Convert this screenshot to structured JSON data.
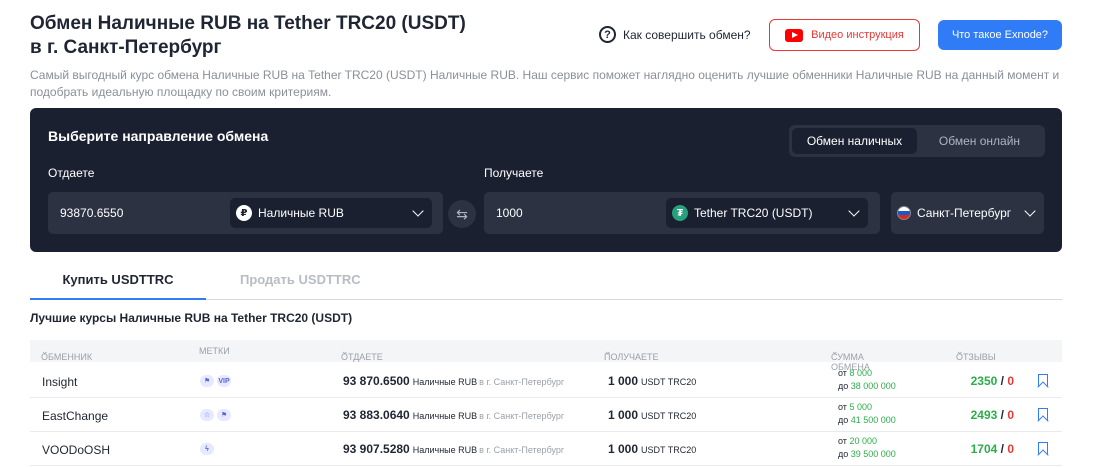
{
  "header": {
    "title_line1": "Обмен Наличные RUB на Tether TRC20 (USDT)",
    "title_line2": "в г. Санкт-Петербург",
    "howto": "Как совершить обмен?",
    "video_btn": "Видео инструкция",
    "exnode_btn": "Что такое Exnode?",
    "description": "Самый выгодный курс обмена Наличные RUB на Tether TRC20 (USDT) Наличные RUB. Наш сервис поможет наглядно оценить лучшие обменники Наличные RUB на данный момент и подобрать идеальную площадку по своим критериям."
  },
  "exchange": {
    "title": "Выберите направление обмена",
    "mode_cash": "Обмен наличных",
    "mode_online": "Обмен онлайн",
    "give_label": "Отдаете",
    "receive_label": "Получаете",
    "give_amount": "93870.6550",
    "give_currency": "Наличные RUB",
    "receive_amount": "1000",
    "receive_currency": "Tether TRC20 (USDT)",
    "city": "Санкт-Петербург"
  },
  "tabs": {
    "buy": "Купить USDTTRC",
    "sell": "Продать USDTTRC"
  },
  "table": {
    "title": "Лучшие курсы Наличные RUB на Tether TRC20 (USDT)",
    "columns": {
      "exchanger": "ОБМЕННИК",
      "tags": "МЕТКИ",
      "give": "ОТДАЕТЕ",
      "receive": "ПОЛУЧАЕТЕ",
      "sum": "СУММА ОБМЕНА",
      "reviews": "ОТЗЫВЫ"
    },
    "rows": [
      {
        "name": "Insight",
        "give": "93 870.6500",
        "give_cur": "Наличные RUB",
        "city": "в г. Санкт-Петербург",
        "recv": "1 000",
        "recv_cur": "USDT TRC20",
        "from_label": "от ",
        "from": "8 000",
        "to_label": "до ",
        "to": "38 000 000",
        "pos": "2350",
        "neg": "0"
      },
      {
        "name": "EastChange",
        "give": "93 883.0640",
        "give_cur": "Наличные RUB",
        "city": "в г. Санкт-Петербург",
        "recv": "1 000",
        "recv_cur": "USDT TRC20",
        "from_label": "от ",
        "from": "5 000",
        "to_label": "до ",
        "to": "41 500 000",
        "pos": "2493",
        "neg": "0"
      },
      {
        "name": "VOODoOSH",
        "give": "93 907.5280",
        "give_cur": "Наличные RUB",
        "city": "в г. Санкт-Петербург",
        "recv": "1 000",
        "recv_cur": "USDT TRC20",
        "from_label": "от ",
        "from": "20 000",
        "to_label": "до ",
        "to": "39 500 000",
        "pos": "1704",
        "neg": "0"
      }
    ]
  },
  "colors": {
    "accent": "#2f7cf6",
    "panel": "#1b2030",
    "positive": "#2bad4a",
    "negative": "#e53935"
  }
}
